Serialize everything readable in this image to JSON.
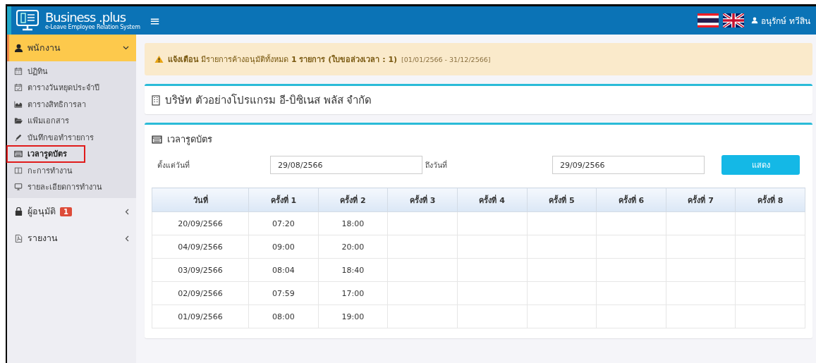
{
  "header": {
    "brand": "Business .plus",
    "tagline": "e-Leave Employee Relation System",
    "menu_glyph": "≡",
    "user": "อนุรักษ์ ทวีสิน"
  },
  "sidebar": {
    "groups": [
      {
        "label": "พนักงาน",
        "expanded": true,
        "children": [
          {
            "label": "ปฏิทิน",
            "selected": false
          },
          {
            "label": "ตารางวันหยุดประจำปี",
            "selected": false
          },
          {
            "label": "ตารางสิทธิการลา",
            "selected": false
          },
          {
            "label": "แฟ้มเอกสาร",
            "selected": false
          },
          {
            "label": "บันทึกขอทำรายการ",
            "selected": false
          },
          {
            "label": "เวลารูดบัตร",
            "selected": true
          },
          {
            "label": "กะการทำงาน",
            "selected": false
          },
          {
            "label": "รายละเอียดการทำงาน",
            "selected": false
          }
        ]
      },
      {
        "label": "ผู้อนุมัติ",
        "expanded": false,
        "badge": "1"
      },
      {
        "label": "รายงาน",
        "expanded": false
      }
    ]
  },
  "alert": {
    "message": "**แจ้งเตือน** มีรายการค้างอนุมัติทั้งหมด **1 รายการ (ใบขอล่วงเวลา : 1)**",
    "range": "[01/01/2566 - 31/12/2566]"
  },
  "company": {
    "title": "บริษัท ตัวอย่างโปรแกรม อี-บิซิเนส พลัส จำกัด"
  },
  "timecard": {
    "title": "เวลารูดบัตร",
    "from_label": "ตั้งแต่วันที่",
    "from_value": "29/08/2566",
    "to_label": "ถึงวันที่",
    "to_value": "29/09/2566",
    "button": "แสดง",
    "table": {
      "columns": [
        "วันที่",
        "ครั้งที่ 1",
        "ครั้งที่ 2",
        "ครั้งที่ 3",
        "ครั้งที่ 4",
        "ครั้งที่ 5",
        "ครั้งที่ 6",
        "ครั้งที่ 7",
        "ครั้งที่ 8"
      ],
      "rows": [
        {
          "date": "20/09/2566",
          "times": [
            "07:20",
            "18:00"
          ]
        },
        {
          "date": "04/09/2566",
          "times": [
            "09:00",
            "20:00"
          ]
        },
        {
          "date": "03/09/2566",
          "times": [
            "08:04",
            "18:40"
          ]
        },
        {
          "date": "02/09/2566",
          "times": [
            "07:59",
            "17:00"
          ]
        },
        {
          "date": "01/09/2566",
          "times": [
            "08:00",
            "19:00"
          ]
        }
      ]
    }
  }
}
